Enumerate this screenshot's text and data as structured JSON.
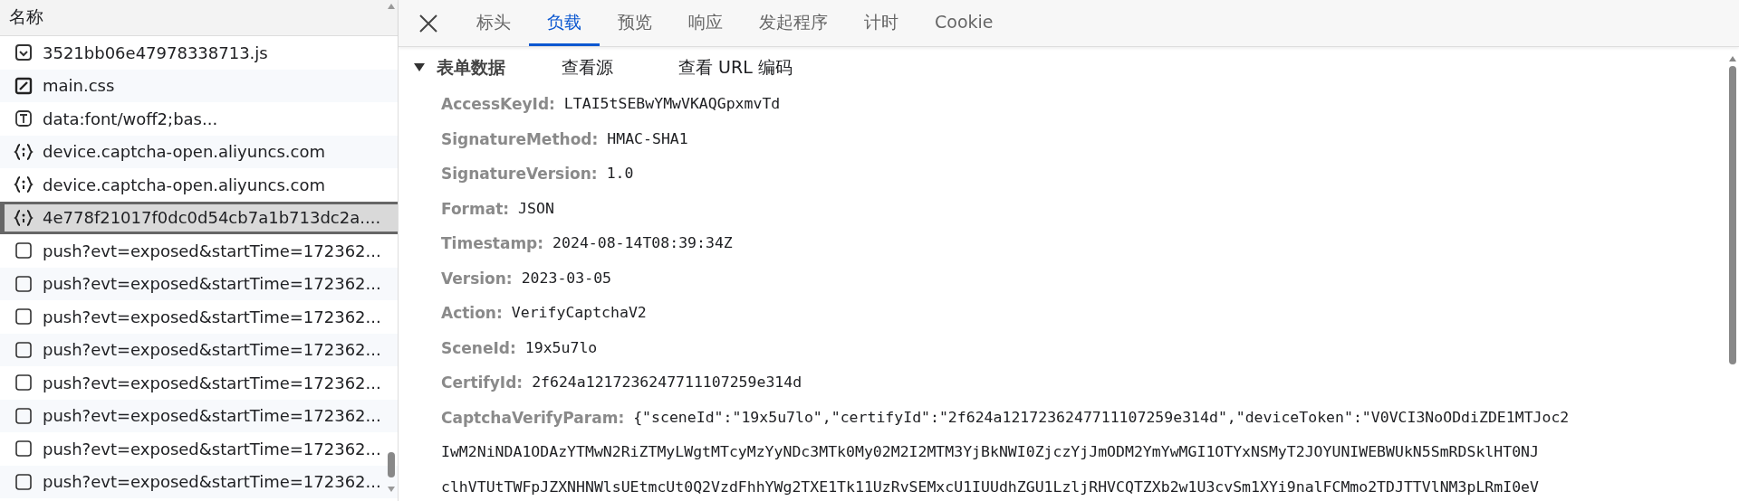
{
  "request_list": {
    "header": "名称",
    "items": [
      {
        "name": "3521bb06e47978338713.js",
        "kind": "script",
        "selected": false
      },
      {
        "name": "main.css",
        "kind": "stylesheet",
        "selected": false
      },
      {
        "name": "data:font/woff2;bas...",
        "kind": "font",
        "selected": false
      },
      {
        "name": "device.captcha-open.aliyuncs.com",
        "kind": "fetch",
        "selected": false
      },
      {
        "name": "device.captcha-open.aliyuncs.com",
        "kind": "fetch",
        "selected": false
      },
      {
        "name": "4e778f21017f0dc0d54cb7a1b713dc2a....",
        "kind": "fetch",
        "selected": true
      },
      {
        "name": "push?evt=exposed&startTime=172362...",
        "kind": "other",
        "selected": false
      },
      {
        "name": "push?evt=exposed&startTime=172362...",
        "kind": "other",
        "selected": false
      },
      {
        "name": "push?evt=exposed&startTime=172362...",
        "kind": "other",
        "selected": false
      },
      {
        "name": "push?evt=exposed&startTime=172362...",
        "kind": "other",
        "selected": false
      },
      {
        "name": "push?evt=exposed&startTime=172362...",
        "kind": "other",
        "selected": false
      },
      {
        "name": "push?evt=exposed&startTime=172362...",
        "kind": "other",
        "selected": false
      },
      {
        "name": "push?evt=exposed&startTime=172362...",
        "kind": "other",
        "selected": false
      },
      {
        "name": "push?evt=exposed&startTime=172362...",
        "kind": "other",
        "selected": false
      }
    ]
  },
  "tabs": [
    {
      "label": "标头",
      "selected": false
    },
    {
      "label": "负载",
      "selected": true
    },
    {
      "label": "预览",
      "selected": false
    },
    {
      "label": "响应",
      "selected": false
    },
    {
      "label": "发起程序",
      "selected": false
    },
    {
      "label": "计时",
      "selected": false
    },
    {
      "label": "Cookie",
      "selected": false
    }
  ],
  "section": {
    "title": "表单数据",
    "expanded": true,
    "links": [
      "查看源",
      "查看 URL 编码"
    ]
  },
  "fields": [
    {
      "key": "AccessKeyId:",
      "value": "LTAI5tSEBwYMwVKAQGpxmvTd"
    },
    {
      "key": "SignatureMethod:",
      "value": "HMAC-SHA1"
    },
    {
      "key": "SignatureVersion:",
      "value": "1.0"
    },
    {
      "key": "Format:",
      "value": "JSON"
    },
    {
      "key": "Timestamp:",
      "value": "2024-08-14T08:39:34Z"
    },
    {
      "key": "Version:",
      "value": "2023-03-05"
    },
    {
      "key": "Action:",
      "value": "VerifyCaptchaV2"
    },
    {
      "key": "SceneId:",
      "value": "19x5u7lo"
    },
    {
      "key": "CertifyId:",
      "value": "2f624a1217236247711107259e314d"
    },
    {
      "key": "CaptchaVerifyParam:",
      "value": "{\"sceneId\":\"19x5u7lo\",\"certifyId\":\"2f624a1217236247711107259e314d\",\"deviceToken\":\"V0VCI3NoODdiZDE1MTJoc2",
      "continuation": [
        "IwM2NiNDA1ODAzYTMwN2RiZTMyLWgtMTcyMzYyNDc3MTk0My02M2I2MTM3YjBkNWI0ZjczYjJmODM2YmYwMGI1OTYxNSMyT2JOYUNIWEBWUkN5SmRDSklHT0NJ",
        "clhVTUtTWFpJZXNHNWlsUEtmcUt0Q2VzdFhhYWg2TXE1Tk11UzRvSEMxcU1IUUdhZGU1LzljRHVCQTZXb2w1U3cvSm1XYi9nalFCMmo2TDJTTVlNM3pLRmI0eV"
      ]
    }
  ]
}
